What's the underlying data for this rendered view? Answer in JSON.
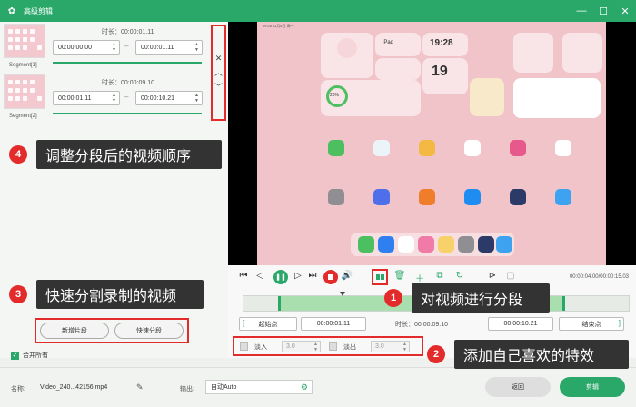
{
  "window": {
    "title": "高级剪辑",
    "min": "—",
    "max": "☐",
    "close": "✕"
  },
  "segments": [
    {
      "label": "Segment[1]",
      "duration_label": "时长：00:00:01.11",
      "start": "00:00:00.00",
      "end": "00:00:01.11"
    },
    {
      "label": "Segment[2]",
      "duration_label": "时长：00:00:09.10",
      "start": "00:00:01.11",
      "end": "00:00:10.21"
    }
  ],
  "seg_side": {
    "close": "✕",
    "up": "︿",
    "down": "﹀"
  },
  "preview": {
    "status_time": "09:28  11月6日 周一",
    "widget_clock": "19:28",
    "widget_day": "19",
    "widget_device": "iPad",
    "widget_battery": "26%"
  },
  "controls": {
    "time_total": "00:00:04.00/00:00:15.03"
  },
  "timeline_row": {
    "start_label": "起始点",
    "start_value": "00:00:01.11",
    "duration": "时长：00:00:09.10",
    "end_value": "00:00:10.21",
    "end_label": "结束点"
  },
  "effects": {
    "fade_in_label": "淡入",
    "fade_in_value": "3.0",
    "fade_out_label": "淡出",
    "fade_out_value": "3.0"
  },
  "split_area": {
    "new_segment": "新增片段",
    "quick_split": "快速分段"
  },
  "merge": {
    "label": "合并所有"
  },
  "bottom": {
    "name_label": "名称:",
    "name_value": "Video_240...42156.mp4",
    "output_label": "输出:",
    "output_value": "自动Auto",
    "back": "返回",
    "edit": "剪辑"
  },
  "callouts": [
    {
      "num": "1",
      "text": "对视频进行分段"
    },
    {
      "num": "2",
      "text": "添加自己喜欢的特效"
    },
    {
      "num": "3",
      "text": "快速分割录制的视频"
    },
    {
      "num": "4",
      "text": "调整分段后的视频顺序"
    }
  ],
  "colors": {
    "accent": "#2aa86a",
    "highlight": "#e32b2b",
    "callout_bg": "#333333"
  }
}
